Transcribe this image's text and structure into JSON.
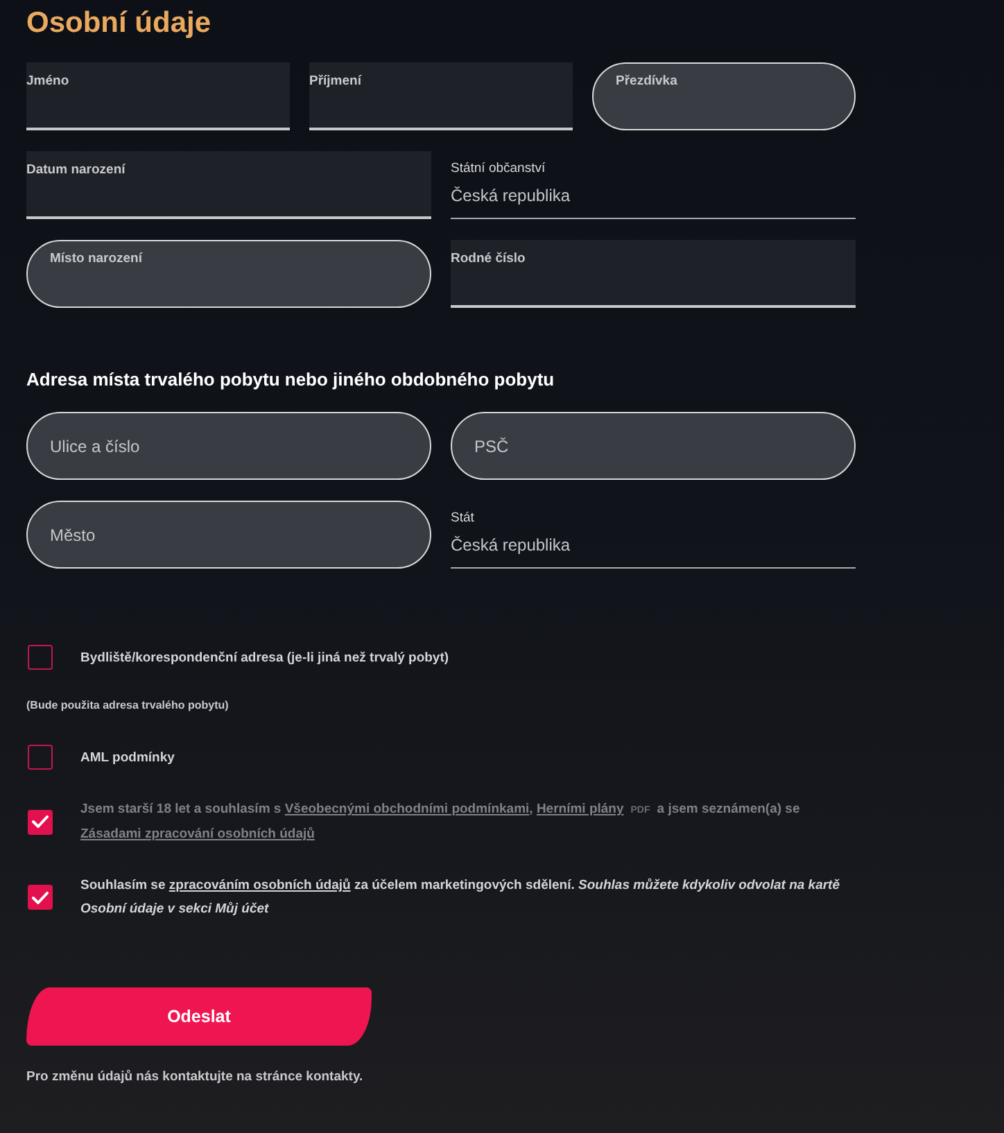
{
  "title": "Osobní údaje",
  "personal_rows": [
    {
      "fields": [
        {
          "kind": "filled",
          "label": "Jméno"
        },
        {
          "kind": "filled",
          "label": "Příjmení"
        },
        {
          "kind": "outlined",
          "label": "Přezdívka"
        }
      ]
    },
    {
      "fields": [
        {
          "kind": "filled",
          "label": "Datum narození"
        },
        {
          "kind": "plain",
          "label": "Státní občanství",
          "value": "Česká republika"
        }
      ]
    },
    {
      "fields": [
        {
          "kind": "outlined",
          "label": "Místo narození"
        },
        {
          "kind": "filled",
          "label": "Rodné číslo"
        }
      ]
    }
  ],
  "address": {
    "heading": "Adresa místa trvalého pobytu nebo jiného obdobného pobytu",
    "rows": [
      {
        "fields": [
          {
            "kind": "outlined",
            "placeholder": "Ulice a číslo"
          },
          {
            "kind": "outlined",
            "placeholder": "PSČ"
          }
        ]
      },
      {
        "fields": [
          {
            "kind": "outlined",
            "placeholder": "Město"
          },
          {
            "kind": "plain",
            "label": "Stát",
            "value": "Česká republika"
          }
        ]
      }
    ]
  },
  "checkboxes": [
    {
      "checked": false,
      "disabled": false,
      "segments": [
        {
          "kind": "text",
          "text": "Bydliště/korespondenční adresa (je-li jiná než trvalý pobyt)"
        }
      ],
      "note": "(Bude použita adresa trvalého pobytu)"
    },
    {
      "checked": false,
      "disabled": false,
      "segments": [
        {
          "kind": "text",
          "text": "AML podmínky"
        }
      ]
    },
    {
      "checked": true,
      "disabled": true,
      "segments": [
        {
          "kind": "text",
          "text": "Jsem starší 18 let a souhlasím s "
        },
        {
          "kind": "link",
          "text": "Všeobecnými obchodními podmínkami"
        },
        {
          "kind": "text",
          "text": ", "
        },
        {
          "kind": "link",
          "text": "Herními plány"
        },
        {
          "kind": "tag",
          "text": "PDF"
        },
        {
          "kind": "text",
          "text": "a jsem seznámen(a) se "
        },
        {
          "kind": "link",
          "text": "Zásadami zpracování osobních údajů"
        }
      ]
    },
    {
      "checked": true,
      "disabled": false,
      "segments": [
        {
          "kind": "text",
          "text": "Souhlasím se "
        },
        {
          "kind": "link",
          "text": "zpracováním osobních údajů"
        },
        {
          "kind": "text",
          "text": " za účelem marketingových sdělení. "
        },
        {
          "kind": "italic",
          "text": "Souhlas můžete kdykoliv odvolat na kartě Osobní údaje v sekci Můj účet"
        }
      ]
    }
  ],
  "submit_button": "Odeslat",
  "footer_note": "Pro změnu údajů nás kontaktujte na stránce kontakty."
}
